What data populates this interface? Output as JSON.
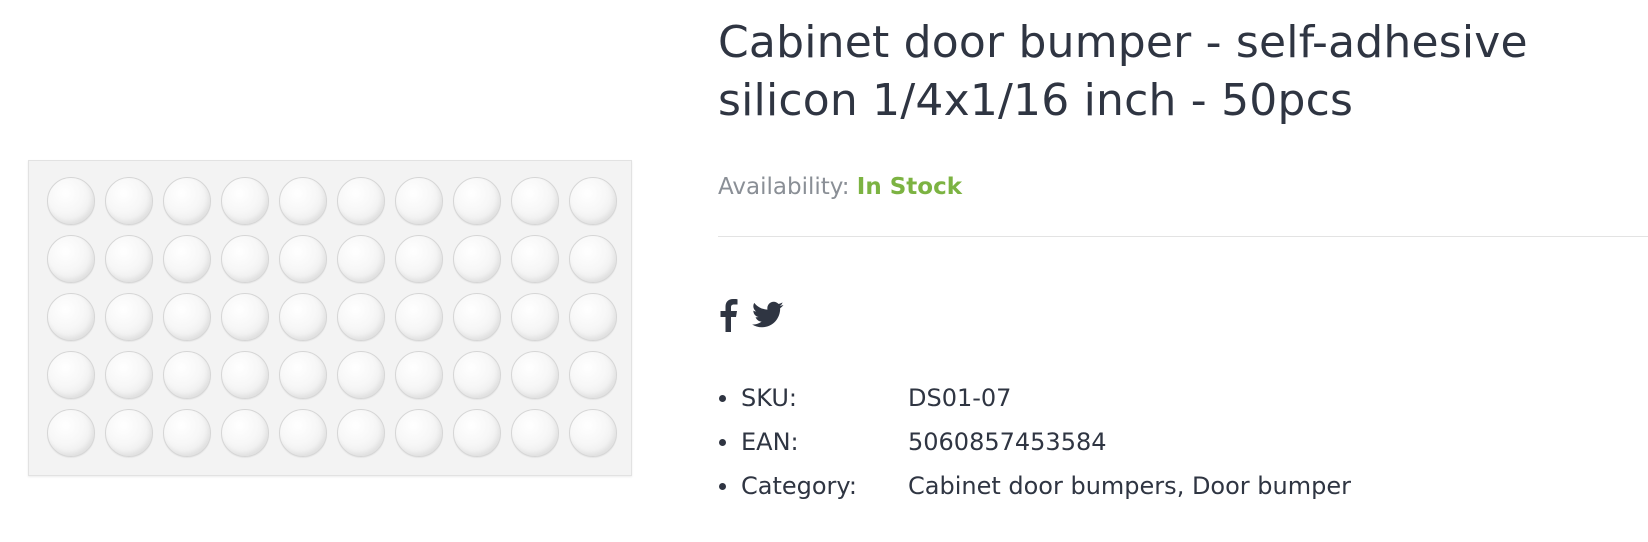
{
  "product": {
    "title": "Cabinet door bumper - self-adhesive silicon 1/4x1/16 inch - 50pcs",
    "image": {
      "rows": 5,
      "columns": 10
    },
    "availability": {
      "label": "Availability:",
      "value": "In Stock",
      "color": "#7cb342"
    },
    "share": [
      {
        "icon": "facebook-icon"
      },
      {
        "icon": "twitter-icon"
      }
    ],
    "meta": {
      "sku": {
        "label": "SKU:",
        "value": "DS01-07"
      },
      "ean": {
        "label": "EAN:",
        "value": "5060857453584"
      },
      "category": {
        "label": "Category:",
        "links": [
          "Cabinet door bumpers",
          "Door bumper"
        ],
        "separator": ", "
      }
    }
  }
}
